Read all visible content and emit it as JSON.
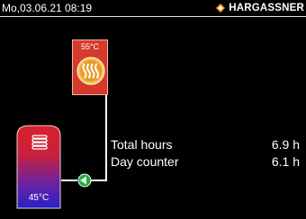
{
  "status": {
    "datetime": "Mo,03.06.21 08:19",
    "brand": "HARGASSNER"
  },
  "boiler": {
    "temperature": "55°C",
    "icon": "heat-waves-icon"
  },
  "tank": {
    "temperature": "45°C",
    "icon": "coil-icon"
  },
  "pump": {
    "icon": "pump-icon",
    "state": "running"
  },
  "stats": [
    {
      "label": "Total hours",
      "value": "6.9 h"
    },
    {
      "label": "Day counter",
      "value": "6.1 h"
    }
  ],
  "colors": {
    "boiler_red": "#d63a2c",
    "tank_red": "#d8202c",
    "tank_blue": "#2a20c8",
    "pump_green": "#1fae3a",
    "brand_orange": "#f39a1e"
  }
}
